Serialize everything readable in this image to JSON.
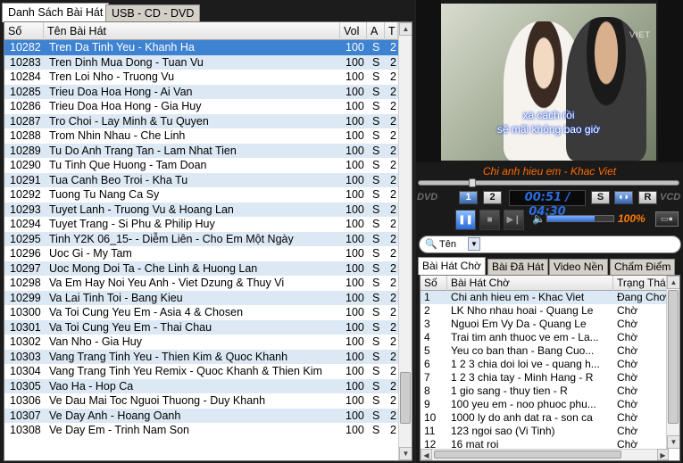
{
  "left_tabs": [
    "Danh Sách Bài Hát",
    "USB - CD - DVD"
  ],
  "song_table": {
    "headers": [
      "Số",
      "Tên Bài Hát",
      "Vol",
      "A",
      "T"
    ],
    "rows": [
      {
        "num": "10282",
        "title": "Tren Da Tinh Yeu - Khanh Ha",
        "vol": "100",
        "a": "S",
        "t": "2",
        "selected": true
      },
      {
        "num": "10283",
        "title": "Tren Dinh Mua Dong - Tuan Vu",
        "vol": "100",
        "a": "S",
        "t": "2"
      },
      {
        "num": "10284",
        "title": "Tren Loi Nho - Truong Vu",
        "vol": "100",
        "a": "S",
        "t": "2"
      },
      {
        "num": "10285",
        "title": "Trieu Doa Hoa Hong - Ai Van",
        "vol": "100",
        "a": "S",
        "t": "2"
      },
      {
        "num": "10286",
        "title": "Trieu Doa Hoa Hong - Gia Huy",
        "vol": "100",
        "a": "S",
        "t": "2"
      },
      {
        "num": "10287",
        "title": "Tro Choi - Lay Minh & Tu Quyen",
        "vol": "100",
        "a": "S",
        "t": "2"
      },
      {
        "num": "10288",
        "title": "Trom Nhin Nhau - Che Linh",
        "vol": "100",
        "a": "S",
        "t": "2"
      },
      {
        "num": "10289",
        "title": "Tu Do Anh Trang Tan - Lam Nhat Tien",
        "vol": "100",
        "a": "S",
        "t": "2"
      },
      {
        "num": "10290",
        "title": "Tu Tinh Que Huong - Tam Doan",
        "vol": "100",
        "a": "S",
        "t": "2"
      },
      {
        "num": "10291",
        "title": "Tua Canh Beo Troi - Kha Tu",
        "vol": "100",
        "a": "S",
        "t": "2"
      },
      {
        "num": "10292",
        "title": "Tuong Tu Nang Ca Sy",
        "vol": "100",
        "a": "S",
        "t": "2"
      },
      {
        "num": "10293",
        "title": "Tuyet Lanh - Truong Vu & Hoang Lan",
        "vol": "100",
        "a": "S",
        "t": "2"
      },
      {
        "num": "10294",
        "title": "Tuyet Trang - Si Phu & Philip Huy",
        "vol": "100",
        "a": "S",
        "t": "2"
      },
      {
        "num": "10295",
        "title": "Tinh Y2K 06_15- - Diễm Liên - Cho Em Một Ngày",
        "vol": "100",
        "a": "S",
        "t": "2"
      },
      {
        "num": "10296",
        "title": "Uoc Gi - My Tam",
        "vol": "100",
        "a": "S",
        "t": "2"
      },
      {
        "num": "10297",
        "title": "Uoc Mong Doi Ta - Che Linh & Huong Lan",
        "vol": "100",
        "a": "S",
        "t": "2"
      },
      {
        "num": "10298",
        "title": "Va Em Hay Noi Yeu Anh - Viet Dzung & Thuy Vi",
        "vol": "100",
        "a": "S",
        "t": "2"
      },
      {
        "num": "10299",
        "title": "Va Lai Tinh Toi - Bang Kieu",
        "vol": "100",
        "a": "S",
        "t": "2"
      },
      {
        "num": "10300",
        "title": "Va Toi Cung Yeu Em - Asia 4 & Chosen",
        "vol": "100",
        "a": "S",
        "t": "2"
      },
      {
        "num": "10301",
        "title": "Va Toi Cung Yeu Em - Thai Chau",
        "vol": "100",
        "a": "S",
        "t": "2"
      },
      {
        "num": "10302",
        "title": "Van Nho - Gia Huy",
        "vol": "100",
        "a": "S",
        "t": "2"
      },
      {
        "num": "10303",
        "title": "Vang Trang Tinh Yeu - Thien Kim & Quoc Khanh",
        "vol": "100",
        "a": "S",
        "t": "2"
      },
      {
        "num": "10304",
        "title": "Vang Trang Tinh Yeu Remix - Quoc Khanh & Thien Kim",
        "vol": "100",
        "a": "S",
        "t": "2"
      },
      {
        "num": "10305",
        "title": "Vao Ha - Hop Ca",
        "vol": "100",
        "a": "S",
        "t": "2"
      },
      {
        "num": "10306",
        "title": "Ve Dau Mai Toc Nguoi Thuong - Duy Khanh",
        "vol": "100",
        "a": "S",
        "t": "2"
      },
      {
        "num": "10307",
        "title": "Ve Day Anh - Hoang Oanh",
        "vol": "100",
        "a": "S",
        "t": "2"
      },
      {
        "num": "10308",
        "title": "Ve Day Em - Trinh Nam Son",
        "vol": "100",
        "a": "S",
        "t": "2"
      }
    ]
  },
  "video": {
    "logo": "VIET",
    "lyric_line1": "xa cách rồi",
    "lyric_line2": "sẽ mãi không bao giờ"
  },
  "now_playing": "Chi anh hieu em - Khac Viet",
  "controls": {
    "dvd_label": "DVD",
    "vcd_label": "VCD",
    "btn1": "1",
    "btn2": "2",
    "time": "00:51 / 04:30",
    "btn_s": "S",
    "btn_r": "R",
    "volume_percent": "100%",
    "volume_level": 0.72
  },
  "search": {
    "field_label": "Tên",
    "value": ""
  },
  "queue_tabs": [
    "Bài Hát Chờ",
    "Bài Đã Hát",
    "Video Nền",
    "Chấm Điểm"
  ],
  "queue_table": {
    "headers": [
      "Số",
      "Bài Hát Chờ",
      "Trạng Thái"
    ],
    "rows": [
      {
        "no": "1",
        "name": "Chi anh hieu em - Khac Viet",
        "status": "Đang Chơi",
        "selected": true
      },
      {
        "no": "2",
        "name": "LK Nho nhau hoai - Quang Le",
        "status": "Chờ"
      },
      {
        "no": "3",
        "name": "Nguoi Em Vy Da - Quang Le",
        "status": "Chờ"
      },
      {
        "no": "4",
        "name": "Trai tim anh thuoc ve em - La...",
        "status": "Chờ"
      },
      {
        "no": "5",
        "name": "Yeu co ban than - Bang Cuo...",
        "status": "Chờ"
      },
      {
        "no": "6",
        "name": "1 2 3 chia doi loi ve - quang h...",
        "status": "Chờ"
      },
      {
        "no": "7",
        "name": "1 2 3 chia tay - Minh Hang - R",
        "status": "Chờ"
      },
      {
        "no": "8",
        "name": "1 gio sang - thuy tien - R",
        "status": "Chờ"
      },
      {
        "no": "9",
        "name": "100 yeu em - noo phuoc phu...",
        "status": "Chờ"
      },
      {
        "no": "10",
        "name": "1000 ly do anh dat ra - son ca",
        "status": "Chờ"
      },
      {
        "no": "11",
        "name": "123 ngoi sao (Vi Tinh)",
        "status": "Chờ"
      },
      {
        "no": "12",
        "name": "16 mat roi",
        "status": "Chờ"
      }
    ]
  }
}
